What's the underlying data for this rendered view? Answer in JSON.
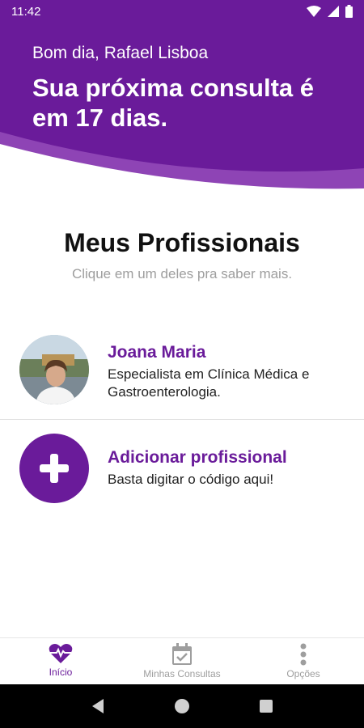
{
  "status_bar": {
    "time": "11:42"
  },
  "header": {
    "greeting": "Bom dia, Rafael Lisboa",
    "headline": "Sua próxima consulta é em 17 dias."
  },
  "section": {
    "title": "Meus Profissionais",
    "subtitle": "Clique em um deles pra saber mais."
  },
  "professionals": [
    {
      "name": "Joana Maria",
      "specialty": "Especialista em Clínica Médica e Gastroenterologia."
    }
  ],
  "add_professional": {
    "title": "Adicionar profissional",
    "text": "Basta digitar o código aqui!"
  },
  "bottom_nav": {
    "tabs": [
      {
        "label": "Início",
        "icon": "heart-pulse-icon",
        "active": true
      },
      {
        "label": "Minhas Consultas",
        "icon": "calendar-check-icon",
        "active": false
      },
      {
        "label": "Opções",
        "icon": "more-vertical-icon",
        "active": false
      }
    ]
  },
  "colors": {
    "brand_purple": "#6a1b9a",
    "wave_light": "#8e44b5",
    "inactive": "#9e9e9e"
  }
}
